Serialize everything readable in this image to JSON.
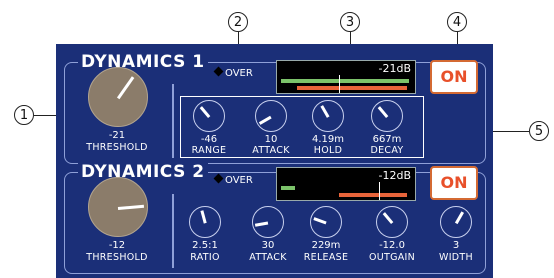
{
  "callouts": [
    "1",
    "2",
    "3",
    "4",
    "5"
  ],
  "dyn1": {
    "title": "DYNAMICS 1",
    "over": "OVER",
    "meter_text": "-21dB",
    "on_label": "ON",
    "threshold": {
      "value": "-21",
      "label": "THRESHOLD"
    },
    "knobs": [
      {
        "value": "-46",
        "label": "RANGE"
      },
      {
        "value": "10",
        "label": "ATTACK"
      },
      {
        "value": "4.19m",
        "label": "HOLD"
      },
      {
        "value": "667m",
        "label": "DECAY"
      }
    ]
  },
  "dyn2": {
    "title": "DYNAMICS 2",
    "over": "OVER",
    "meter_text": "-12dB",
    "on_label": "ON",
    "threshold": {
      "value": "-12",
      "label": "THRESHOLD"
    },
    "knobs": [
      {
        "value": "2.5:1",
        "label": "RATIO"
      },
      {
        "value": "30",
        "label": "ATTACK"
      },
      {
        "value": "229m",
        "label": "RELEASE"
      },
      {
        "value": "-12.0",
        "label": "OUTGAIN"
      },
      {
        "value": "3",
        "label": "WIDTH"
      }
    ]
  },
  "colors": {
    "panel": "#1b2f78",
    "on_text": "#e8502a",
    "meter_green": "#7cc36a",
    "meter_orange": "#e8643a"
  }
}
